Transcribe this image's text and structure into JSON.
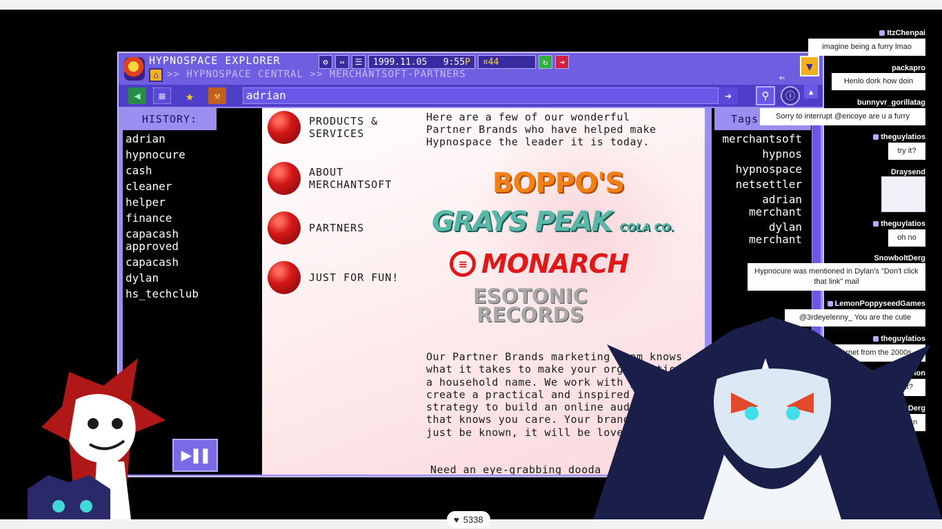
{
  "browser": {
    "app_title": "HYPNOSPACE EXPLORER",
    "breadcrumb": ">> HYPNOSPACE CENTRAL >> MERCHANTSOFT-PARTNERS",
    "date": "1999.11.05",
    "time": "9:55",
    "time_suffix": "P",
    "counter": "44",
    "address": "adrian"
  },
  "history": {
    "title": "HISTORY:",
    "items": [
      "adrian",
      "hypnocure",
      "cash",
      "cleaner",
      "helper",
      "finance",
      "capacash approved",
      "capacash",
      "dylan",
      "hs_techclub"
    ]
  },
  "page": {
    "menu": [
      "PRODUCTS & SERVICES",
      "ABOUT MERCHANTSOFT",
      "PARTNERS",
      "JUST FOR FUN!"
    ],
    "intro": "Here are a few of our wonderful Partner Brands who have helped make Hypnospace the leader it is today.",
    "brands": {
      "boppo": "BOPPO'S",
      "grays": "GRAYS PEAK",
      "grays_sub": "COLA CO.",
      "monarch": "MONARCH",
      "esotonic_1": "ESOTONIC",
      "esotonic_2": "RECORDS"
    },
    "body": "Our Partner Brands marketing team knows what it takes to make your organization a household name. We work with you to create a practical and inspired strategy to build an online audience that knows you care. Your brand won't just be known, it will be loved.",
    "cut_line": "Need an eye-grabbing dooda"
  },
  "tags": {
    "title": "Tags",
    "items": [
      "merchantsoft",
      "hypnos",
      "hypnospace",
      "netsettler",
      "adrian merchant",
      "dylan merchant"
    ]
  },
  "chat": [
    {
      "user": "ItzChenpai",
      "msg": "imagine being a furry lmao"
    },
    {
      "user": "packapro",
      "msg": "Henlo dork how doin"
    },
    {
      "user": "bunnyvr_gorillatag",
      "msg": "Sorry to interrupt @encoye are u a furry"
    },
    {
      "user": "theguylatios",
      "msg": "try it?"
    },
    {
      "user": "Draysend",
      "msg": ""
    },
    {
      "user": "theguylatios",
      "msg": "oh no"
    },
    {
      "user": "SnowboltDerg",
      "msg": "Hypnocure was mentioned in Dylan's \"Don't click that link\" mail"
    },
    {
      "user": "LemonPoppyseedGames",
      "msg": "@3rdeyelenny_ You are the cutie"
    },
    {
      "user": "theguylatios",
      "msg": "ernet from the 2000s"
    },
    {
      "user": "Meliarion",
      "msg": "epartment?"
    },
    {
      "user": "boltDerg",
      "msg": "Dylan"
    }
  ],
  "stream": {
    "likes": "5338"
  },
  "colors": {
    "window": "#9a8ff0",
    "titlebar": "#6f5fe0",
    "page_bg": "#fde8ea",
    "accent_red": "#d41818"
  }
}
